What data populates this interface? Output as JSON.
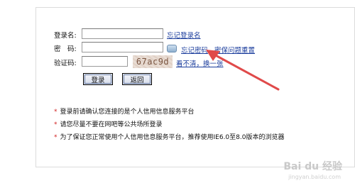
{
  "form": {
    "username_label": "登录名:",
    "password_label": "密　码:",
    "captcha_label": "验证码:",
    "forgot_login_name": "忘记登录名",
    "forgot_password": "忘记密码",
    "reset_by_question": "密保问题重置",
    "captcha_text": "67ac9d",
    "refresh_captcha": "看不清，换一张",
    "login_button": "登录",
    "back_button": "返回"
  },
  "notes": [
    "登录前请确认您连接的是个人信用信息服务平台",
    "请您尽量不要在网吧等公共场所登录",
    "为了保证您正常使用个人信用信息服务平台，推荐使用IE6.0至8.0版本的浏览器"
  ],
  "annotation": {
    "arrow_color": "#e04a4a"
  },
  "watermark": {
    "text": "Bai du 经验",
    "sub": "jingyan.baidu.com"
  }
}
